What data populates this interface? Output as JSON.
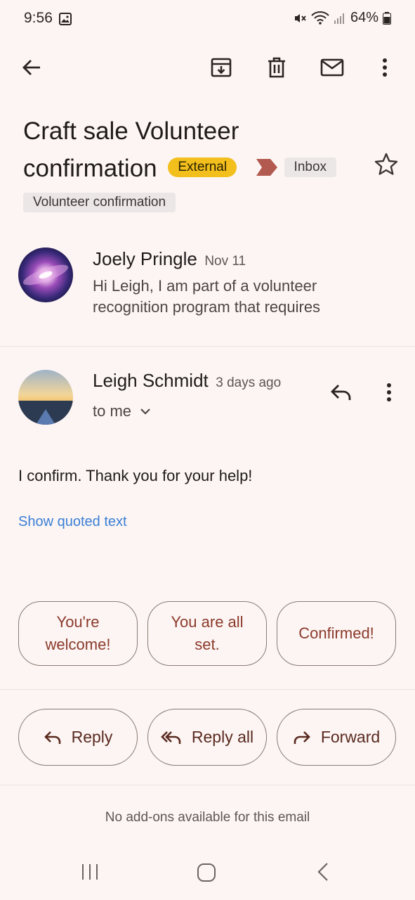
{
  "status_bar": {
    "time": "9:56",
    "battery": "64%"
  },
  "toolbar": {
    "back": "back-icon",
    "archive": "archive-icon",
    "delete": "trash-icon",
    "mark_unread": "mail-icon",
    "more": "more-vert-icon"
  },
  "email": {
    "subject": "Craft sale Volunteer confirmation",
    "subject_line1": "Craft sale Volunteer",
    "subject_line2": "confirmation",
    "external_badge": "External",
    "inbox_label": "Inbox",
    "label_chip": "Volunteer confirmation"
  },
  "messages": [
    {
      "sender": "Joely Pringle",
      "date": "Nov 11",
      "snippet_line1": "Hi Leigh, I am part of a volunteer",
      "snippet_line2": "recognition program that requires"
    },
    {
      "sender": "Leigh Schmidt",
      "date": "3 days ago",
      "recipient": "to me",
      "body": "I confirm.  Thank you for your help!",
      "show_quoted": "Show quoted text"
    }
  ],
  "smart_replies": [
    {
      "line1": "You're",
      "line2": "welcome!"
    },
    {
      "line1": "You are all",
      "line2": "set."
    },
    {
      "line1": "Confirmed!",
      "line2": ""
    }
  ],
  "actions": {
    "reply": "Reply",
    "reply_all": "Reply all",
    "forward": "Forward"
  },
  "addons": "No add-ons available for this email",
  "colors": {
    "background": "#fcf5f3",
    "badge_external": "#f2bf1c",
    "link": "#3b7fd6",
    "accent": "#8b3a2c",
    "tag": "#b35a50"
  }
}
